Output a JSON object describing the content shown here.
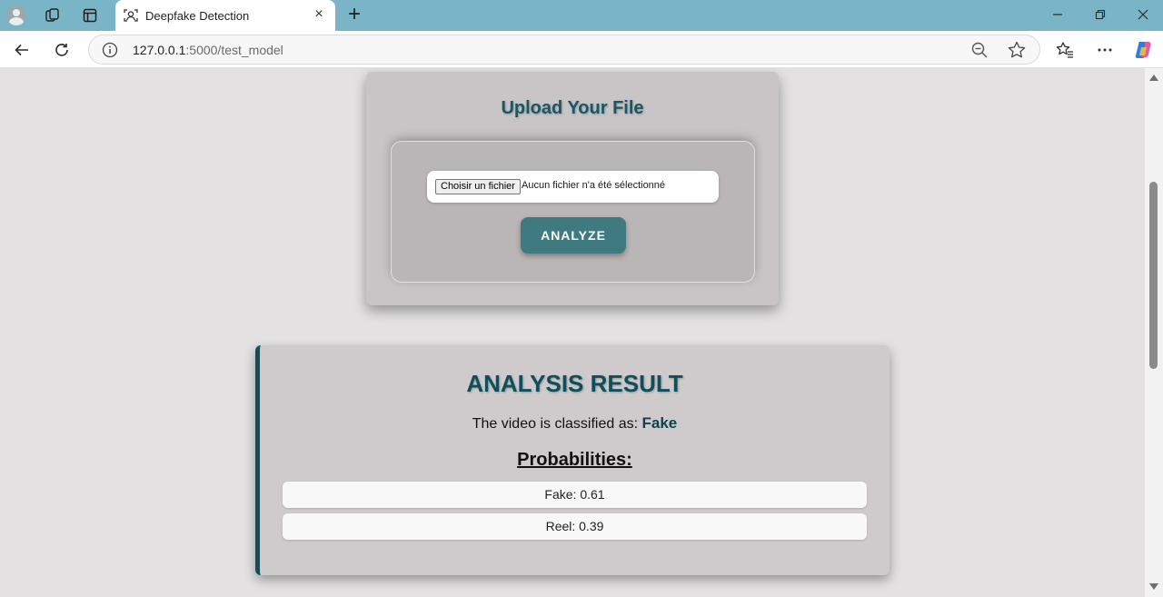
{
  "browser": {
    "tab_title": "Deepfake Detection",
    "url_host": "127.0.0.1",
    "url_rest": ":5000/test_model",
    "icons": {
      "profile": "profile-avatar-icon",
      "collections": "collections-icon",
      "tab_actions": "tab-actions-icon",
      "favicon": "face-scan-icon",
      "tab_close": "close-icon",
      "new_tab": "plus-icon",
      "minimize": "minimize-icon",
      "restore": "restore-icon",
      "close": "close-icon",
      "back": "back-arrow-icon",
      "refresh": "refresh-icon",
      "site_info": "info-icon",
      "zoom": "zoom-out-icon",
      "favorite": "star-icon",
      "favorites": "favorites-icon",
      "more": "more-icon",
      "copilot": "copilot-icon"
    },
    "colors": {
      "tabbar": "#7ab5c7"
    }
  },
  "upload": {
    "title": "Upload Your File",
    "file_button": "Choisir un fichier",
    "file_status": "Aucun fichier n'a été sélectionné",
    "analyze_label": "ANALYZE"
  },
  "result": {
    "title": "ANALYSIS RESULT",
    "classified_prefix": "The video is classified as:",
    "classification": "Fake",
    "probabilities_heading": "Probabilities:",
    "probabilities": [
      {
        "text": "Fake: 0.61"
      },
      {
        "text": "Reel: 0.39"
      }
    ]
  },
  "colors": {
    "accent": "#185866",
    "button": "#3f7a80",
    "result_border": "#0f4f5c",
    "page_bg": "#e3e1e2"
  }
}
